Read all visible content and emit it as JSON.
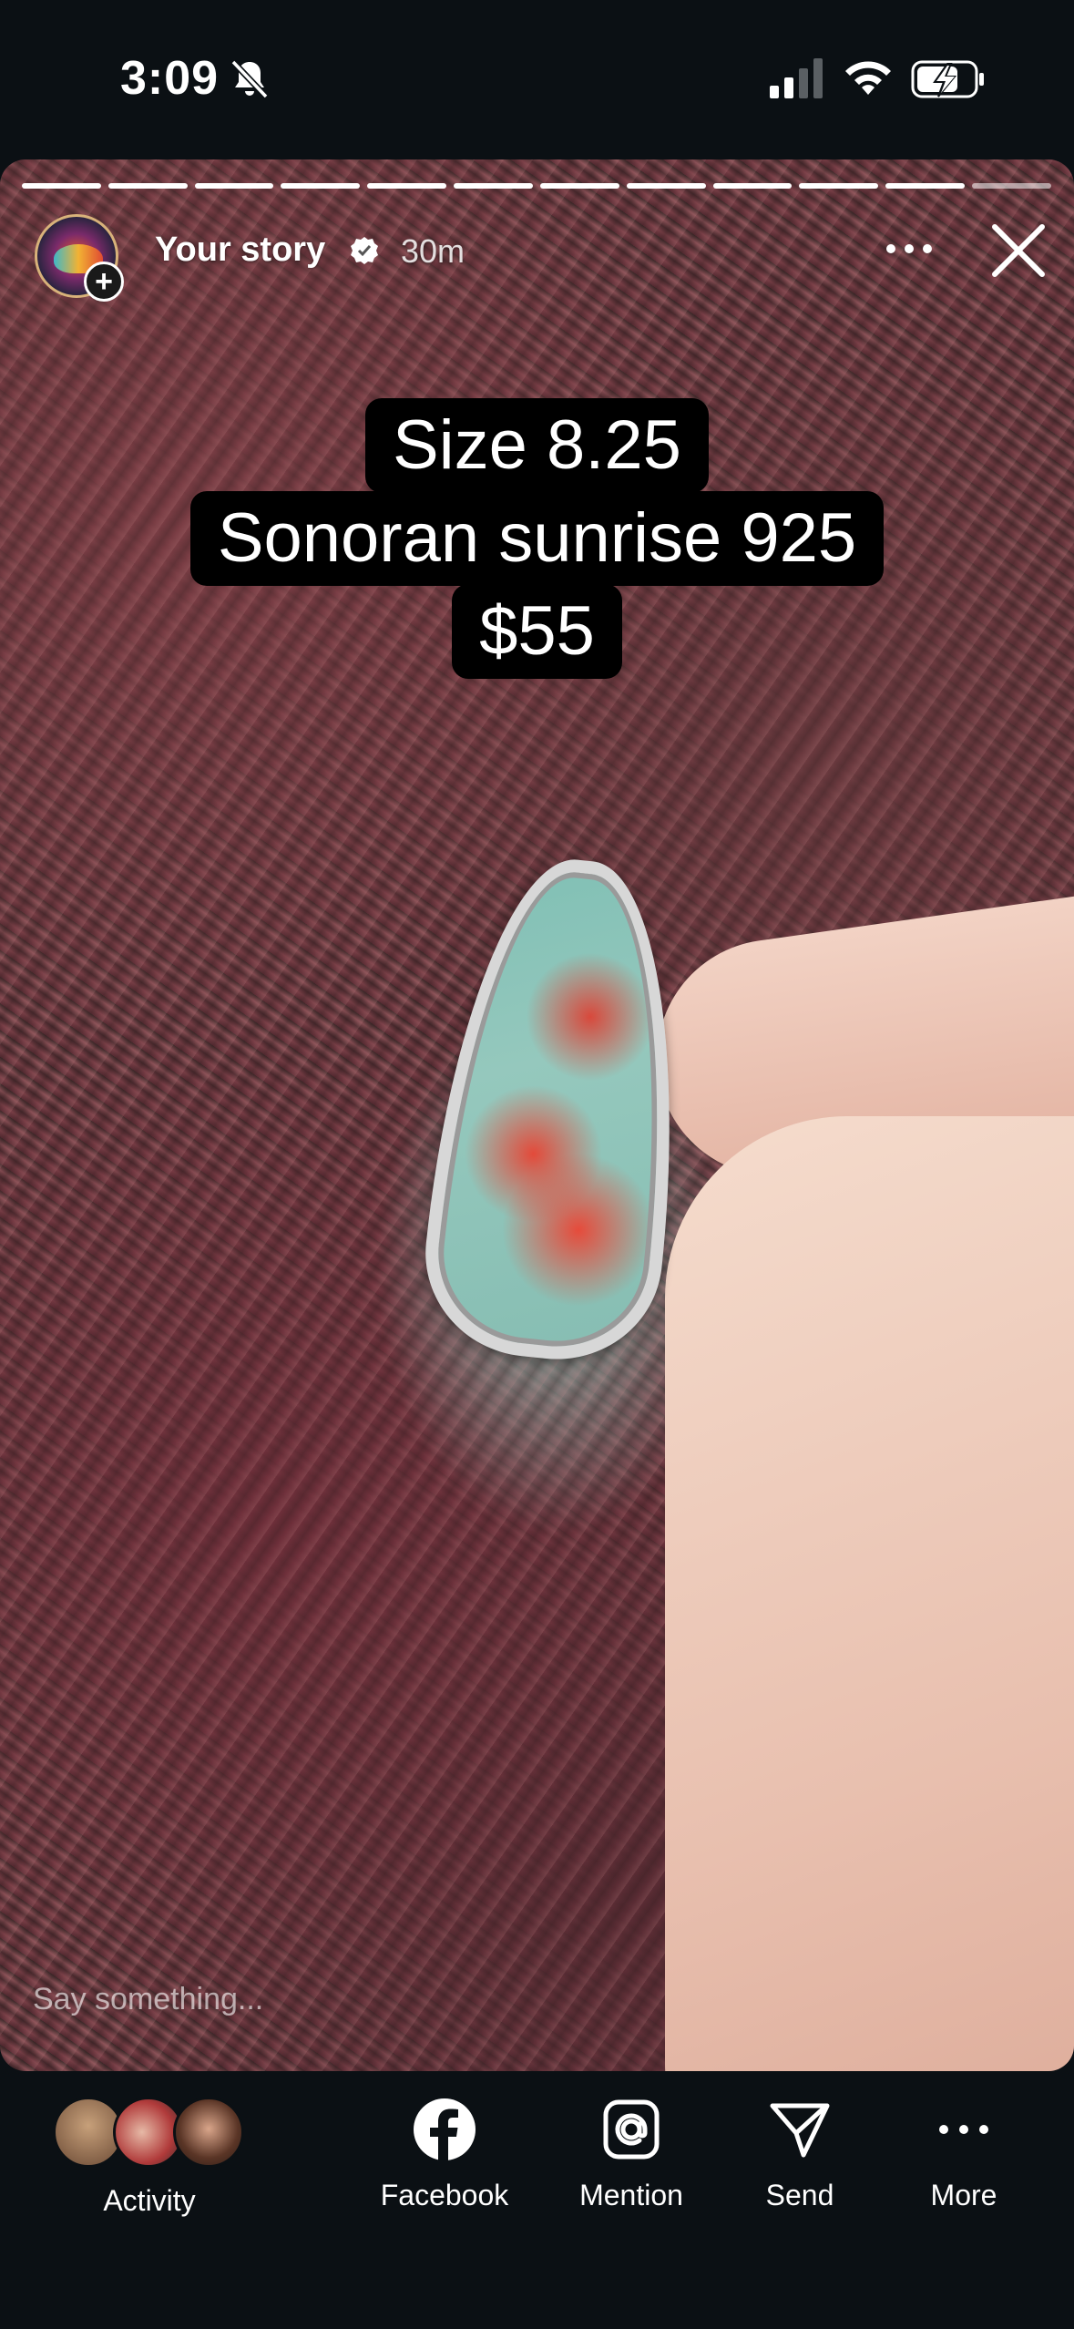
{
  "status_bar": {
    "time": "3:09"
  },
  "story": {
    "username": "Your story",
    "time_ago": "30m",
    "progress_segments": 12,
    "progress_done": 11,
    "caption": {
      "line1": "Size 8.25",
      "line2": "Sonoran sunrise 925",
      "line3": "$55"
    },
    "reply_placeholder": "Say something..."
  },
  "bottom_bar": {
    "activity_label": "Activity",
    "actions": [
      {
        "label": "Facebook",
        "icon": "facebook-icon"
      },
      {
        "label": "Mention",
        "icon": "mention-icon"
      },
      {
        "label": "Send",
        "icon": "send-icon"
      },
      {
        "label": "More",
        "icon": "more-icon"
      }
    ]
  },
  "colors": {
    "background": "#0b1014",
    "text": "#ffffff",
    "caption_bg": "#000000"
  }
}
